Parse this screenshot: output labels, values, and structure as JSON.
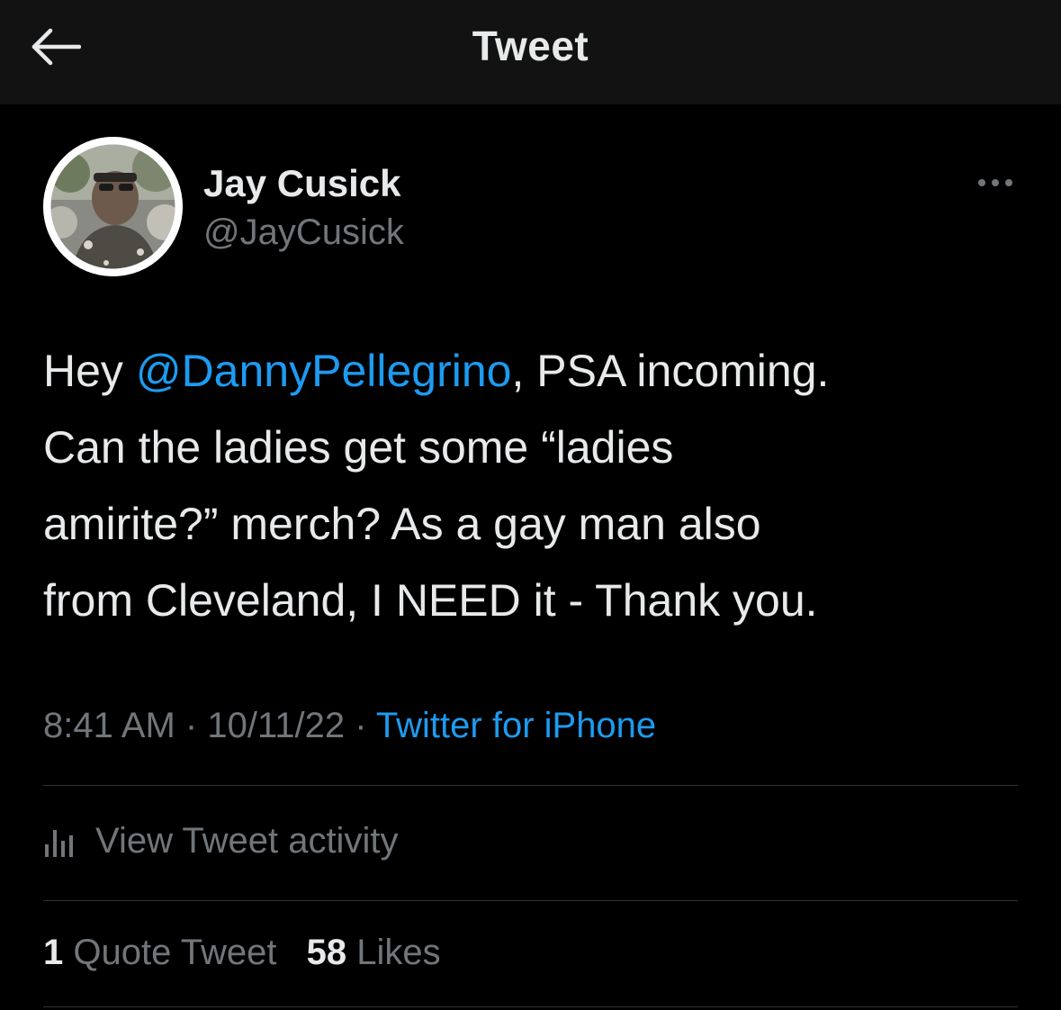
{
  "header": {
    "title": "Tweet",
    "back_icon": "arrow-left-icon"
  },
  "author": {
    "display_name": "Jay Cusick",
    "handle": "@JayCusick",
    "avatar": "profile-photo"
  },
  "tweet": {
    "lines": [
      {
        "pre": "Hey ",
        "mention": "@DannyPellegrino",
        "post": ", PSA incoming."
      },
      {
        "text": "Can the ladies get some “ladies"
      },
      {
        "text": "amirite?” merch? As a gay man also"
      },
      {
        "text": "from Cleveland, I NEED it - Thank you."
      }
    ],
    "time": "8:41 AM",
    "separator": "·",
    "date": "10/11/22",
    "source": "Twitter for iPhone"
  },
  "activity": {
    "label": "View Tweet activity",
    "icon": "bar-chart-icon"
  },
  "stats": {
    "quote_count": "1",
    "quote_label": "Quote Tweet",
    "likes_count": "58",
    "likes_label": "Likes"
  },
  "colors": {
    "background": "#000000",
    "header_background": "#121212",
    "accent": "#1d9bf0",
    "text_primary": "#e7e9ea",
    "text_secondary": "#71767b",
    "divider": "#2f3336"
  }
}
